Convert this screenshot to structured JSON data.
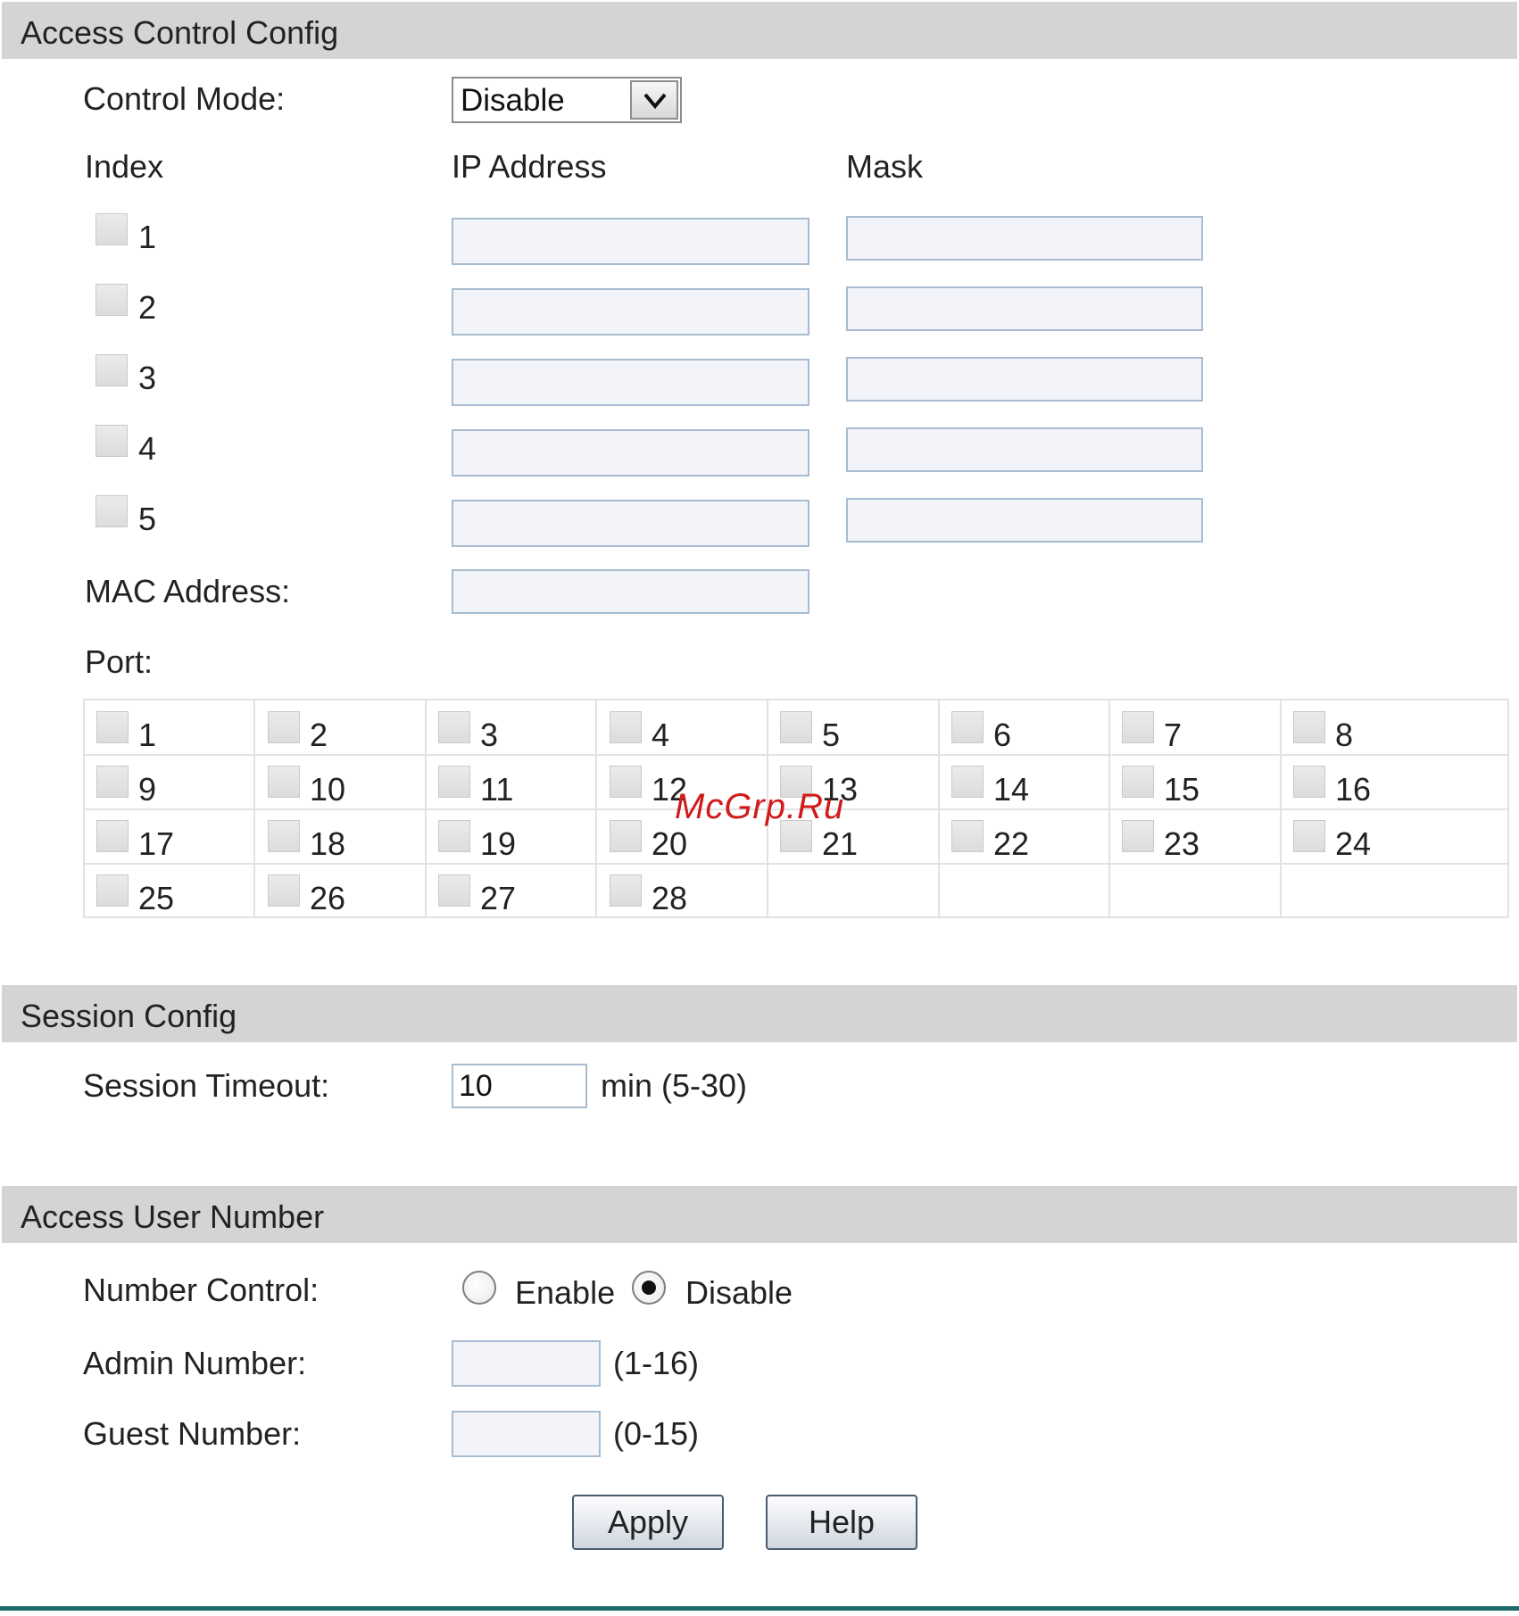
{
  "access_control": {
    "title": "Access Control Config",
    "control_mode_label": "Control Mode:",
    "control_mode_value": "Disable",
    "columns": {
      "index": "Index",
      "ip": "IP Address",
      "mask": "Mask"
    },
    "entries": [
      {
        "index": "1",
        "ip": "",
        "mask": "",
        "checked": false
      },
      {
        "index": "2",
        "ip": "",
        "mask": "",
        "checked": false
      },
      {
        "index": "3",
        "ip": "",
        "mask": "",
        "checked": false
      },
      {
        "index": "4",
        "ip": "",
        "mask": "",
        "checked": false
      },
      {
        "index": "5",
        "ip": "",
        "mask": "",
        "checked": false
      }
    ],
    "mac_label": "MAC Address:",
    "mac_value": "",
    "port_label": "Port:",
    "ports": [
      "1",
      "2",
      "3",
      "4",
      "5",
      "6",
      "7",
      "8",
      "9",
      "10",
      "11",
      "12",
      "13",
      "14",
      "15",
      "16",
      "17",
      "18",
      "19",
      "20",
      "21",
      "22",
      "23",
      "24",
      "25",
      "26",
      "27",
      "28"
    ]
  },
  "session": {
    "title": "Session Config",
    "timeout_label": "Session Timeout:",
    "timeout_value": "10",
    "timeout_unit": "min (5-30)"
  },
  "access_user": {
    "title": "Access User Number",
    "number_control_label": "Number Control:",
    "enable_label": "Enable",
    "disable_label": "Disable",
    "selected": "Disable",
    "admin_label": "Admin Number:",
    "admin_value": "",
    "admin_range": "(1-16)",
    "guest_label": "Guest Number:",
    "guest_value": "",
    "guest_range": "(0-15)"
  },
  "actions": {
    "apply": "Apply",
    "help": "Help"
  },
  "watermark": "McGrp.Ru",
  "colors": {
    "header_bg": "#d4d4d4",
    "input_border": "#a7bcd1",
    "input_bg": "#f2f4f9",
    "footer_rule": "#1e6b6b",
    "watermark": "#d11a1a"
  }
}
